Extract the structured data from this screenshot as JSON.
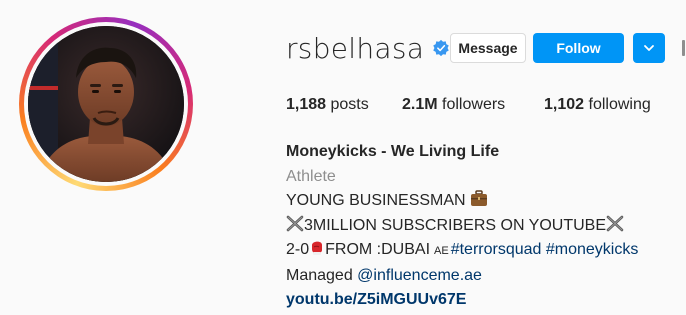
{
  "profile": {
    "username": "rsbelhasa",
    "verified": true,
    "buttons": {
      "message": "Message",
      "follow": "Follow"
    },
    "stats": {
      "posts_count": "1,188",
      "posts_label": "posts",
      "followers_count": "2.1M",
      "followers_label": "followers",
      "following_count": "1,102",
      "following_label": "following"
    },
    "full_name": "Moneykicks - We Living Life",
    "category": "Athlete",
    "bio": {
      "line1": "YOUNG BUSINESSMAN",
      "line2": "3MILLION SUBSCRIBERS ON YOUTUBE",
      "line3_prefix": "2-0",
      "line3_mid": "FROM :DUBAI",
      "line3_flag": "AE",
      "hashtag1": "#terrorsquad",
      "hashtag2": "#moneykicks",
      "managed_prefix": "Managed ",
      "mention": "@influenceme.ae",
      "link": "youtu.be/Z5iMGUUv67E"
    }
  },
  "colors": {
    "accent": "#0095f6",
    "link": "#00376b",
    "secondary_text": "#8e8e8e"
  },
  "icons": [
    "verified-badge-icon",
    "chevron-down-icon",
    "briefcase-icon",
    "cross-swords-icon",
    "boxing-glove-icon"
  ]
}
